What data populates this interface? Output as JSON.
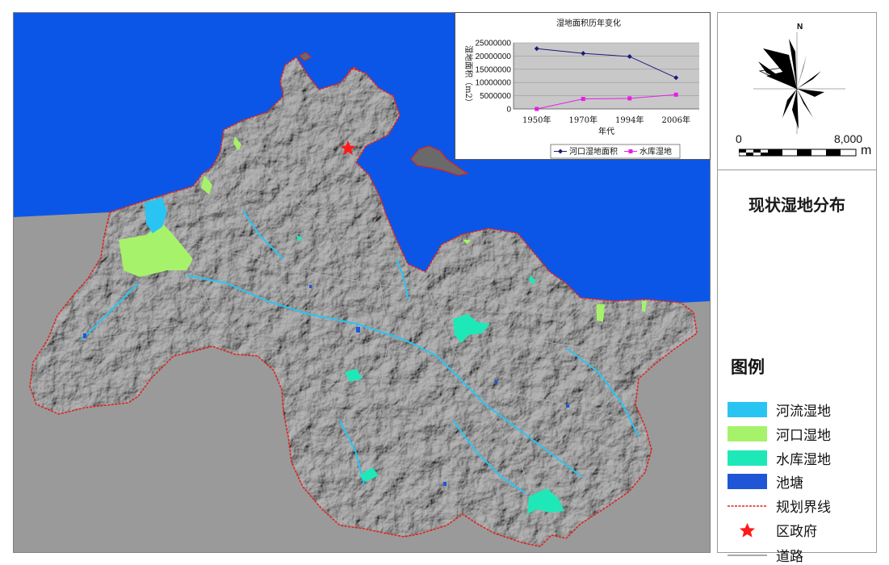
{
  "map": {
    "colors": {
      "sea": "#0b56e6",
      "outside": "#9a9a9a",
      "land": "#5e5e5e",
      "boundary": "#e0231f",
      "river_wetland": "#2ac4f2",
      "estuary_wetland": "#a6f26a",
      "reservoir_wetland": "#1fe8b8",
      "pond": "#1e56d6",
      "district_gov": "#ff1a1a",
      "road": "#b8b8b8"
    }
  },
  "chart_data": {
    "type": "line",
    "title": "湿地面积历年变化",
    "xlabel": "年代",
    "ylabel": "湿地面积（m2）",
    "categories": [
      "1950年",
      "1970年",
      "1994年",
      "2006年"
    ],
    "ylim": [
      0,
      25000000
    ],
    "yticks": [
      "25000000",
      "20000000",
      "15000000",
      "10000000",
      "5000000",
      "0"
    ],
    "grid": true,
    "legend": "bottom",
    "series": [
      {
        "name": "河口湿地面积",
        "color": "#1a1a7a",
        "marker": "diamond",
        "values": [
          22800000,
          21000000,
          19800000,
          11800000
        ]
      },
      {
        "name": "水库湿地",
        "color": "#e61ee6",
        "marker": "square",
        "values": [
          0,
          3800000,
          4000000,
          5400000
        ]
      }
    ]
  },
  "sidebar": {
    "north_label": "N",
    "scale": {
      "start": "0",
      "end": "8,000",
      "unit": "m"
    },
    "map_title": "现状湿地分布",
    "legend_title": "图例",
    "legend": [
      {
        "label": "河流湿地",
        "color": "#2ac4f2",
        "kind": "swatch"
      },
      {
        "label": "河口湿地",
        "color": "#a6f26a",
        "kind": "swatch"
      },
      {
        "label": "水库湿地",
        "color": "#1fe8b8",
        "kind": "swatch"
      },
      {
        "label": "池塘",
        "color": "#1e56d6",
        "kind": "swatch"
      },
      {
        "label": "规划界线",
        "color": "#e0231f",
        "kind": "dashed-line"
      },
      {
        "label": "区政府",
        "color": "#ff1a1a",
        "kind": "star"
      },
      {
        "label": "道路",
        "color": "#555555",
        "kind": "line"
      }
    ]
  }
}
